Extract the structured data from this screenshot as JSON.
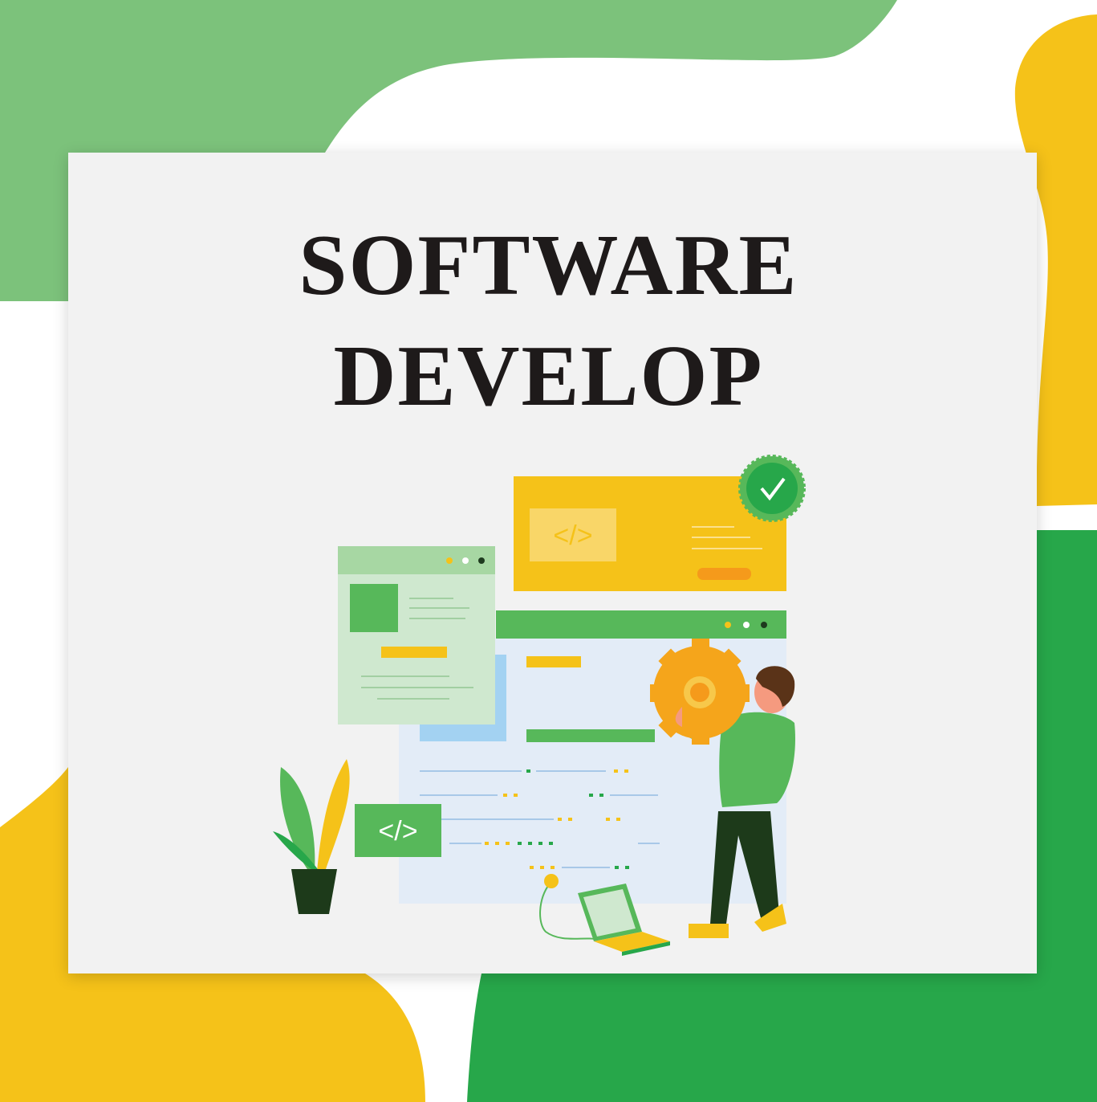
{
  "title": {
    "line1": "SOFTWARE",
    "line2": "DEVELOP"
  },
  "illustration": {
    "code_symbol": "</>",
    "icons": [
      "check-badge-icon",
      "gear-icon",
      "code-icon",
      "plant-icon",
      "laptop-icon",
      "plug-icon"
    ]
  },
  "colors": {
    "green_light": "#7cc27b",
    "green_dark": "#27a74a",
    "yellow": "#f5c219",
    "card": "#f2f2f2",
    "text": "#1e1a1a"
  }
}
